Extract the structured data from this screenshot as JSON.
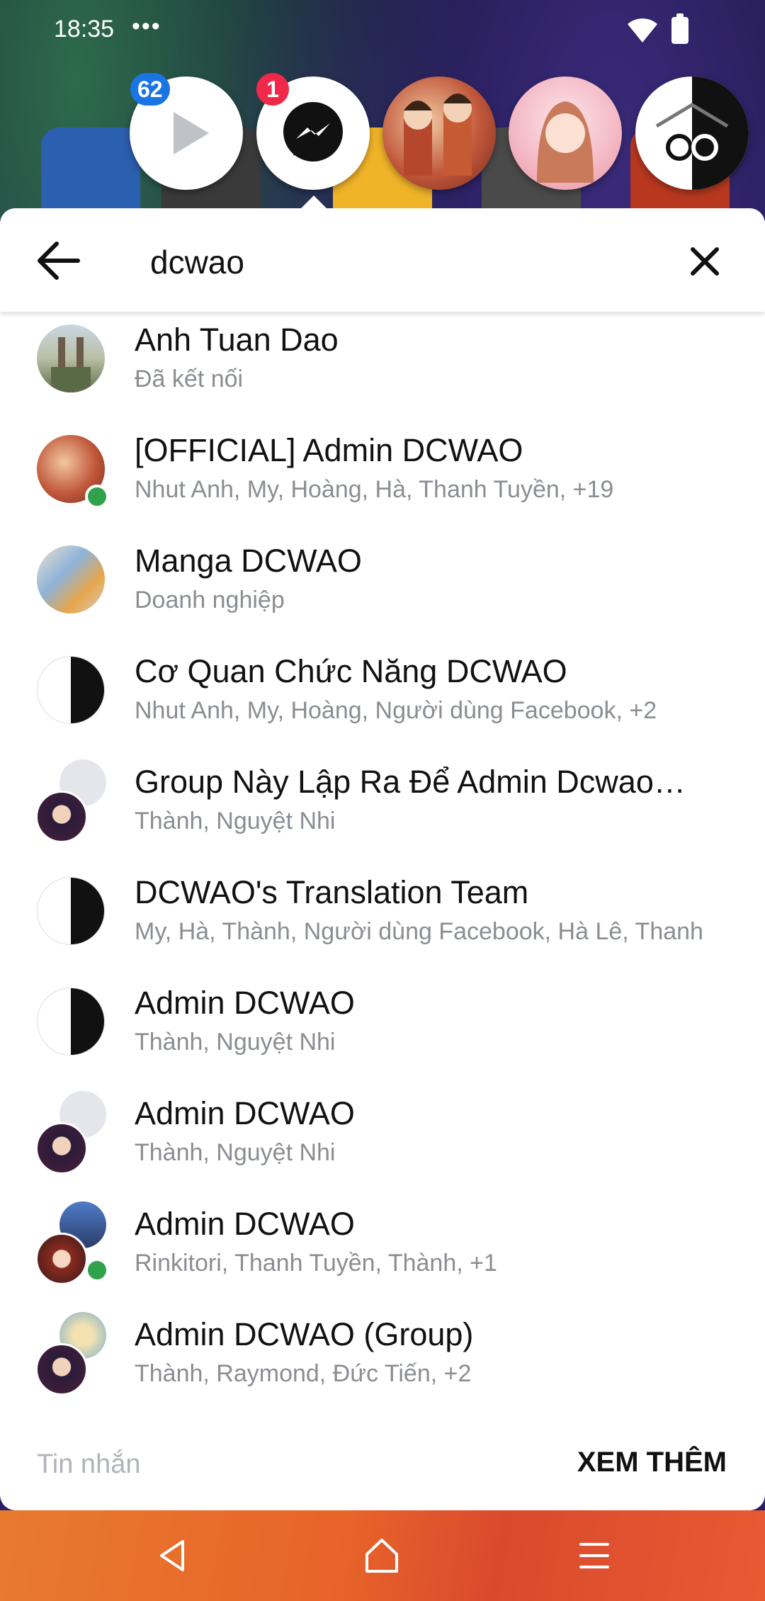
{
  "status_bar": {
    "time": "18:35",
    "dots": "•••"
  },
  "chat_heads": [
    {
      "name": "video-head",
      "badge": "62",
      "badge_color": "#1b74e4"
    },
    {
      "name": "messenger-head",
      "badge": "1",
      "badge_color": "#f02849"
    }
  ],
  "search": {
    "query": "dcwao"
  },
  "results": [
    {
      "name": "Anh Tuan Dao",
      "sub": "Đã kết nối"
    },
    {
      "name": "[OFFICIAL] Admin DCWAO",
      "sub": "Nhut Anh, My, Hoàng, Hà, Thanh Tuyền, +19"
    },
    {
      "name": "Manga DCWAO",
      "sub": "Doanh nghiệp"
    },
    {
      "name": "Cơ Quan Chức Năng DCWAO",
      "sub": "Nhut Anh, My, Hoàng, Người dùng Facebook, +2"
    },
    {
      "name": "Group Này Lập Ra Để Admin Dcwao…",
      "sub": "Thành, Nguyệt Nhi"
    },
    {
      "name": "DCWAO's Translation Team",
      "sub": "My, Hà, Thành, Người dùng Facebook, Hà Lê, Thanh"
    },
    {
      "name": "Admin DCWAO",
      "sub": "Thành, Nguyệt Nhi"
    },
    {
      "name": "Admin DCWAO",
      "sub": "Thành, Nguyệt Nhi"
    },
    {
      "name": "Admin DCWAO",
      "sub": "Rinkitori, Thanh Tuyền, Thành, +1"
    },
    {
      "name": "Admin DCWAO (Group)",
      "sub": "Thành, Raymond, Đức Tiến, +2"
    }
  ],
  "footer": {
    "section_label": "Tin nhắn",
    "see_more": "XEM THÊM"
  },
  "colors": {
    "online": "#31a24c",
    "secondary_text": "#8a8d91"
  }
}
